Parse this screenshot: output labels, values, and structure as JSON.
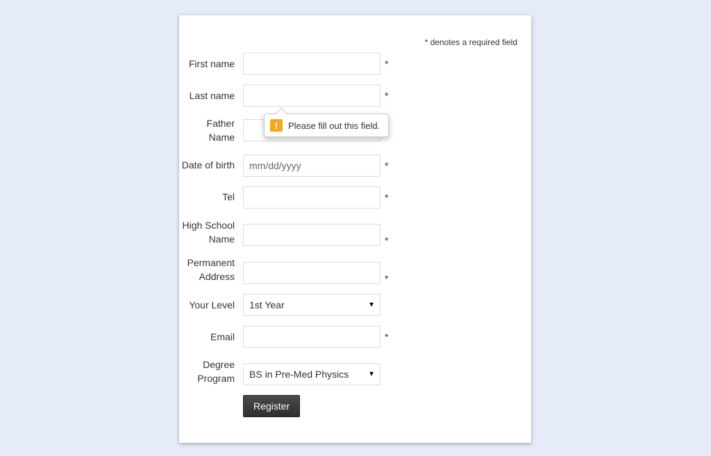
{
  "required_note": "* denotes a required field",
  "form": {
    "first_name": {
      "label": "First name",
      "value": "",
      "required": "*"
    },
    "last_name": {
      "label": "Last name",
      "value": "",
      "required": "*"
    },
    "father_name": {
      "label": "Father Name",
      "value": "",
      "required": ""
    },
    "dob": {
      "label": "Date of birth",
      "placeholder": "mm/dd/yyyy",
      "required": "*"
    },
    "tel": {
      "label": "Tel",
      "value": "",
      "required": "*"
    },
    "highschool": {
      "label": "High School Name",
      "value": "",
      "required": "*"
    },
    "address": {
      "label": "Permanent Address",
      "value": "",
      "required": "*"
    },
    "level": {
      "label": "Your Level",
      "selected": "1st Year",
      "required": ""
    },
    "email": {
      "label": "Email",
      "value": "",
      "required": "*"
    },
    "degree": {
      "label": "Degree Program",
      "selected": "BS in Pre-Med Physics",
      "required": ""
    },
    "submit_label": "Register"
  },
  "tooltip": {
    "text": "Please fill out this field.",
    "icon_glyph": "!"
  }
}
